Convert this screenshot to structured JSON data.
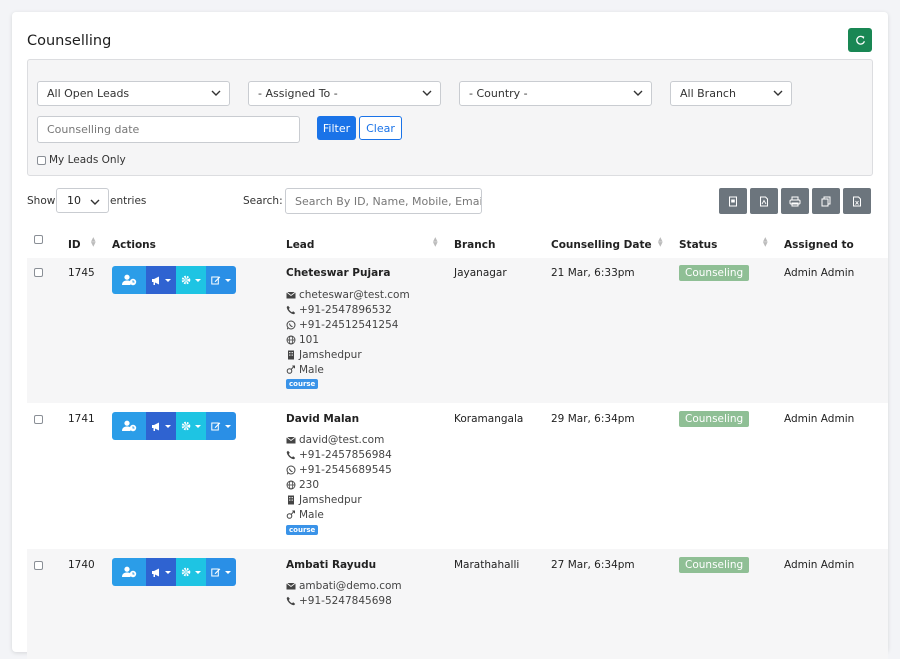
{
  "page": {
    "title": "Counselling"
  },
  "filters": {
    "lead_status": "All Open Leads",
    "assigned_to": "- Assigned To -",
    "country": "- Country -",
    "branch": "All Branch",
    "date_placeholder": "Counselling date",
    "filter_label": "Filter",
    "clear_label": "Clear",
    "my_leads_label": "My Leads Only"
  },
  "table_controls": {
    "show_label": "Show",
    "entries_value": "10",
    "entries_label": "entries",
    "search_label": "Search:",
    "search_placeholder": "Search By ID, Name, Mobile, Email"
  },
  "table": {
    "headers": {
      "id": "ID",
      "actions": "Actions",
      "lead": "Lead",
      "branch": "Branch",
      "date": "Counselling Date",
      "status": "Status",
      "assigned": "Assigned to"
    },
    "rows": [
      {
        "id": "1745",
        "name": "Cheteswar Pujara",
        "email": "cheteswar@test.com",
        "phone": "+91-2547896532",
        "whatsapp": "+91-24512541254",
        "code": "101",
        "city": "Jamshedpur",
        "gender": "Male",
        "tag": "course",
        "branch": "Jayanagar",
        "date": "21 Mar, 6:33pm",
        "status": "Counseling",
        "assigned": "Admin Admin"
      },
      {
        "id": "1741",
        "name": "David Malan",
        "email": "david@test.com",
        "phone": "+91-2457856984",
        "whatsapp": "+91-2545689545",
        "code": "230",
        "city": "Jamshedpur",
        "gender": "Male",
        "tag": "course",
        "branch": "Koramangala",
        "date": "29 Mar, 6:34pm",
        "status": "Counseling",
        "assigned": "Admin Admin"
      },
      {
        "id": "1740",
        "name": "Ambati Rayudu",
        "email": "ambati@demo.com",
        "phone": "+91-5247845698",
        "branch": "Marathahalli",
        "date": "27 Mar, 6:34pm",
        "status": "Counseling",
        "assigned": "Admin Admin"
      }
    ]
  },
  "colors": {
    "primary": "#1a73e8",
    "refresh": "#198754",
    "export": "#6c757d",
    "status_badge": "#8fbf95",
    "tag": "#3a93e8"
  }
}
